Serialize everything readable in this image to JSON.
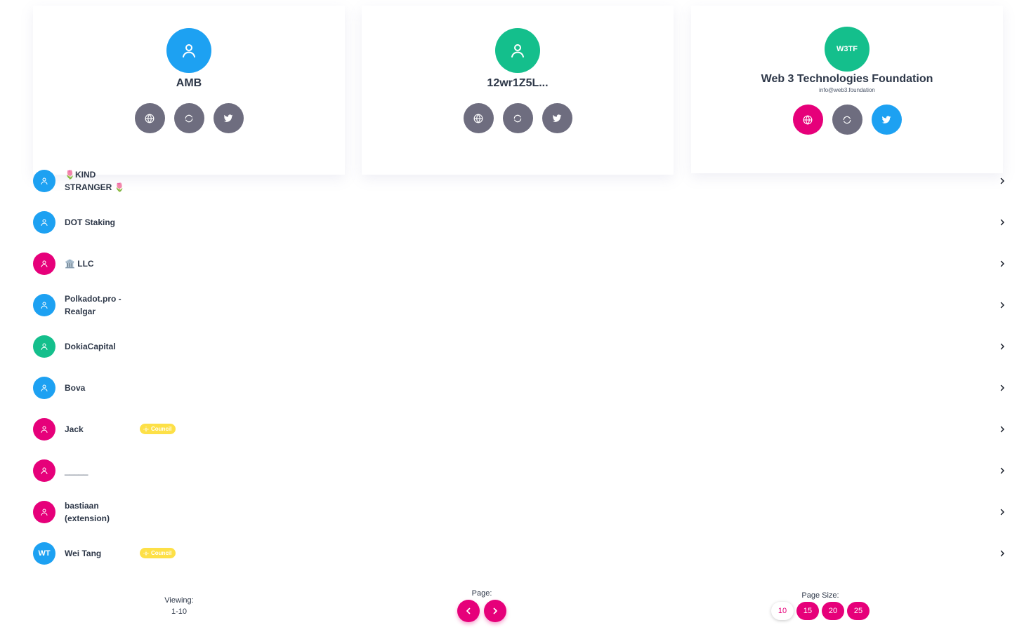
{
  "colors": {
    "blue": "#1da1f2",
    "green": "#14bf8c",
    "pink": "#e6007a",
    "gray": "#6e6d7f",
    "yellow": "#fde047"
  },
  "featured": [
    {
      "name": "AMB",
      "avatar_icon": "user-icon",
      "avatar_color": "#1da1f2",
      "website_active": false,
      "twitter_active": false
    },
    {
      "name": "12wr1Z5L...",
      "avatar_icon": "user-icon",
      "avatar_color": "#14bf8c",
      "website_active": false,
      "twitter_active": false
    },
    {
      "name": "Web 3 Technologies Foundation",
      "avatar_text": "W3TF",
      "email": "info@web3.foundation",
      "avatar_color": "#14bf8c",
      "website_active": true,
      "twitter_active": true
    }
  ],
  "validators": [
    {
      "label": "🌷KIND STRANGER 🌷",
      "avatar_color": "#1da1f2"
    },
    {
      "label": "DOT Staking",
      "avatar_color": "#1da1f2"
    },
    {
      "label": "🏛️ LLC",
      "avatar_color": "#e6007a"
    },
    {
      "label": "Polkadot.pro - Realgar",
      "avatar_color": "#1da1f2"
    },
    {
      "label": "DokiaCapital",
      "avatar_color": "#14bf8c"
    },
    {
      "label": "Bova",
      "avatar_color": "#1da1f2"
    },
    {
      "label": "Jack",
      "avatar_color": "#e6007a",
      "badge": "Council"
    },
    {
      "label": "_____",
      "avatar_color": "#e6007a"
    },
    {
      "label": "bastiaan (extension)",
      "avatar_color": "#e6007a"
    },
    {
      "label": "Wei Tang",
      "avatar_color": "#1da1f2",
      "avatar_text": "WT",
      "badge": "Council"
    }
  ],
  "pagination": {
    "viewing_label": "Viewing:",
    "viewing_range": "1-10",
    "page_label": "Page:",
    "page_size_label": "Page Size:",
    "page_sizes": [
      "10",
      "15",
      "20",
      "25"
    ],
    "selected_page_size": "10"
  }
}
